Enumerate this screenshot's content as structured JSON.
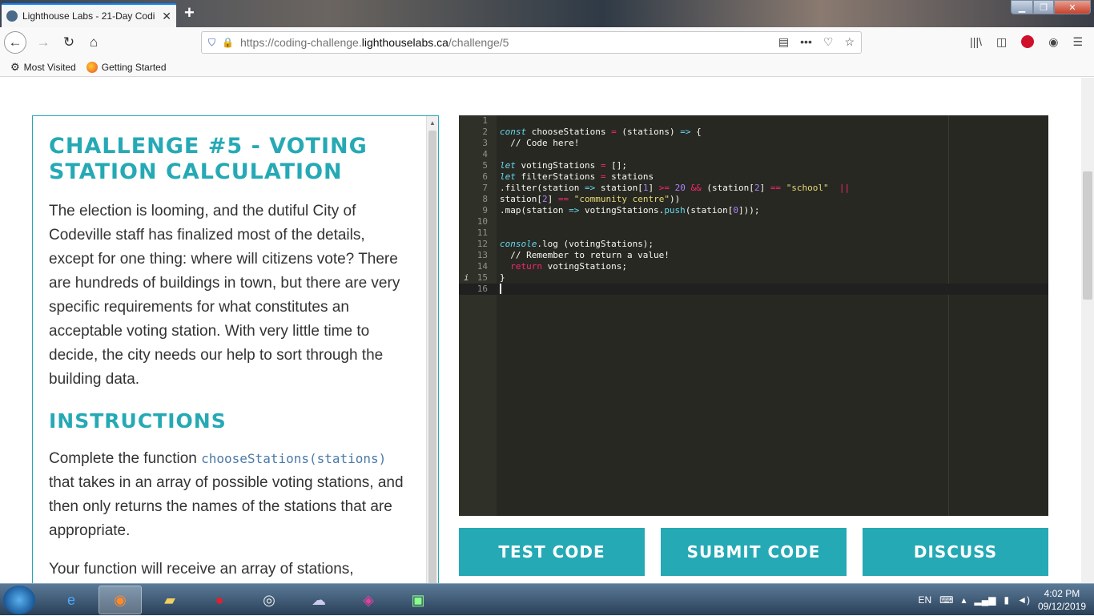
{
  "browser": {
    "tab_title": "Lighthouse Labs - 21-Day Codi",
    "tab_close": "✕",
    "new_tab": "+",
    "url_prefix": "https://coding-challenge.",
    "url_domain": "lighthouselabs.ca",
    "url_path": "/challenge/5",
    "bookmarks": [
      "Most Visited",
      "Getting Started"
    ]
  },
  "challenge": {
    "title": "CHALLENGE #5 - VOTING STATION CALCULATION",
    "intro": "The election is looming, and the dutiful City of Codeville staff has finalized most of the details, except for one thing: where will citizens vote? There are hundreds of buildings in town, but there are very specific requirements for what constitutes an acceptable voting station. With very little time to decide, the city needs our help to sort through the building data.",
    "instructions_heading": "INSTRUCTIONS",
    "instr_pre": "Complete the function ",
    "instr_code": "chooseStations(stations)",
    "instr_post": " that takes in an array of possible voting stations, and then only returns the names of the stations that are appropriate.",
    "next_para": "Your function will receive an array of stations,"
  },
  "editor": {
    "line_numbers": [
      "1",
      "2",
      "3",
      "4",
      "5",
      "6",
      "7",
      "8",
      "9",
      "10",
      "11",
      "12",
      "13",
      "14",
      "15",
      "16"
    ],
    "l2_kw": "const",
    "l2_a": " chooseStations ",
    "l2_op": "=",
    "l2_b": " (stations) ",
    "l2_arrow": "=>",
    "l2_c": " {",
    "l3": "  // Code here!",
    "l5_kw": "let",
    "l5_a": " votingStations ",
    "l5_op": "=",
    "l5_b": " [];",
    "l6_kw": "let",
    "l6_a": " filterStations ",
    "l6_op": "=",
    "l6_b": " stations",
    "l7_a": ".filter(station ",
    "l7_arrow": "=>",
    "l7_b": " station[",
    "l7_n1": "1",
    "l7_c": "] ",
    "l7_ge": ">=",
    "l7_d": " ",
    "l7_n2": "20",
    "l7_e": " ",
    "l7_and": "&&",
    "l7_f": " (station[",
    "l7_n3": "2",
    "l7_g": "] ",
    "l7_eq": "==",
    "l7_h": " ",
    "l7_str": "\"school\"",
    "l7_i": "  ",
    "l7_or": "||",
    "l8_a": "station[",
    "l8_n": "2",
    "l8_b": "] ",
    "l8_eq": "==",
    "l8_c": " ",
    "l8_str": "\"community centre\"",
    "l8_d": "))",
    "l9_a": ".map(station ",
    "l9_arrow": "=>",
    "l9_b": " votingStations.",
    "l9_fn": "push",
    "l9_c": "(station[",
    "l9_n": "0",
    "l9_d": "]));",
    "l12_kw": "console",
    "l12_a": ".log (votingStations);",
    "l13": "  // Remember to return a value!",
    "l14_kw": "  return",
    "l14_a": " votingStations;",
    "l15": "}",
    "info_marker": "i"
  },
  "buttons": {
    "test": "TEST CODE",
    "submit": "SUBMIT CODE",
    "discuss": "DISCUSS"
  },
  "taskbar": {
    "lang": "EN",
    "time": "4:02 PM",
    "date": "09/12/2019"
  },
  "colors": {
    "accent": "#25a9b5",
    "editor_bg": "#272822"
  }
}
